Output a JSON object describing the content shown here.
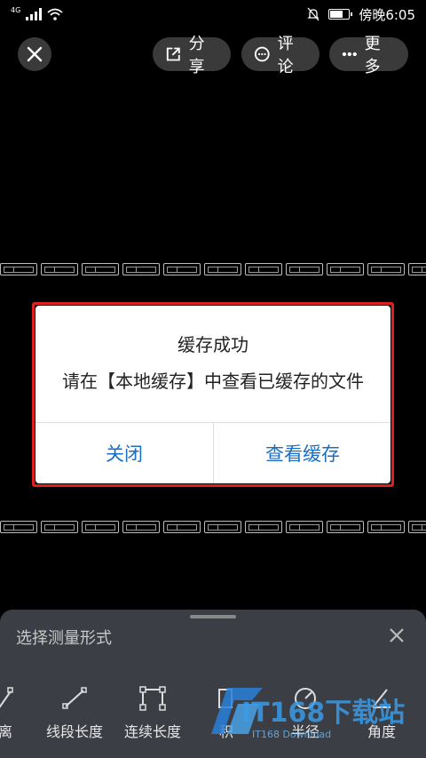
{
  "status_bar": {
    "network_label": "4G",
    "time": "傍晚6:05"
  },
  "toolbar": {
    "share_label": "分享",
    "comment_label": "评论",
    "more_label": "更多"
  },
  "dialog": {
    "title": "缓存成功",
    "message": "请在【本地缓存】中查看已缓存的文件",
    "close_label": "关闭",
    "view_cache_label": "查看缓存"
  },
  "bottom_sheet": {
    "title": "选择测量形式",
    "tools": [
      {
        "label": "离"
      },
      {
        "label": "线段长度"
      },
      {
        "label": "连续长度"
      },
      {
        "label": "积"
      },
      {
        "label": "半径"
      },
      {
        "label": "角度"
      }
    ]
  },
  "watermark": {
    "brand": "IT168下载站",
    "sub": "IT168 Download"
  },
  "colors": {
    "accent_blue": "#1a6fc4",
    "highlight_red": "#e02020",
    "sheet_bg": "#3b3f45"
  }
}
